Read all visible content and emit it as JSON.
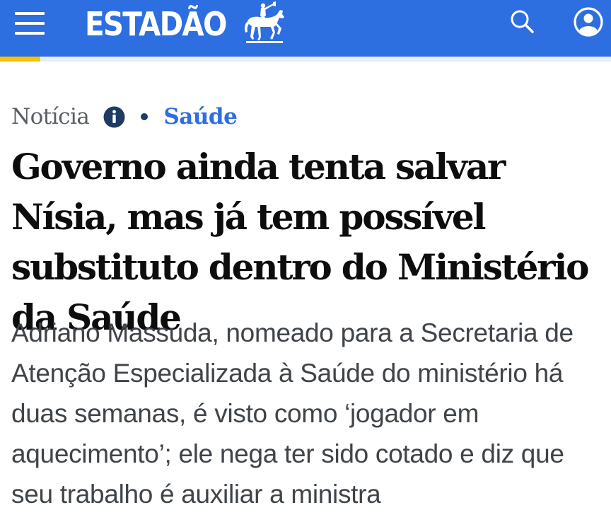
{
  "header": {
    "logo_text": "ESTADÃO",
    "menu_icon": "hamburger-menu-icon",
    "logo_icon": "horse-rider-icon",
    "search_icon": "search-icon",
    "user_icon": "user-icon",
    "background_color": "#2d6ee0"
  },
  "reading_progress": {
    "fraction": 0.066,
    "color": "#f7c300"
  },
  "article": {
    "type_label": "Notícia",
    "info_icon": "info-icon",
    "section": "Saúde",
    "section_color": "#2d6ee0",
    "headline": "Governo ainda tenta salvar Nísia, mas já tem possível substituto dentro do Ministério da Saúde",
    "subtitle": "Adriano Massuda, nomeado para a Secretaria de Atenção Especializada à Saúde do ministério há duas semanas, é visto como ‘jogador em aquecimento’; ele nega ter sido cotado e diz que seu trabalho é auxiliar a ministra"
  }
}
